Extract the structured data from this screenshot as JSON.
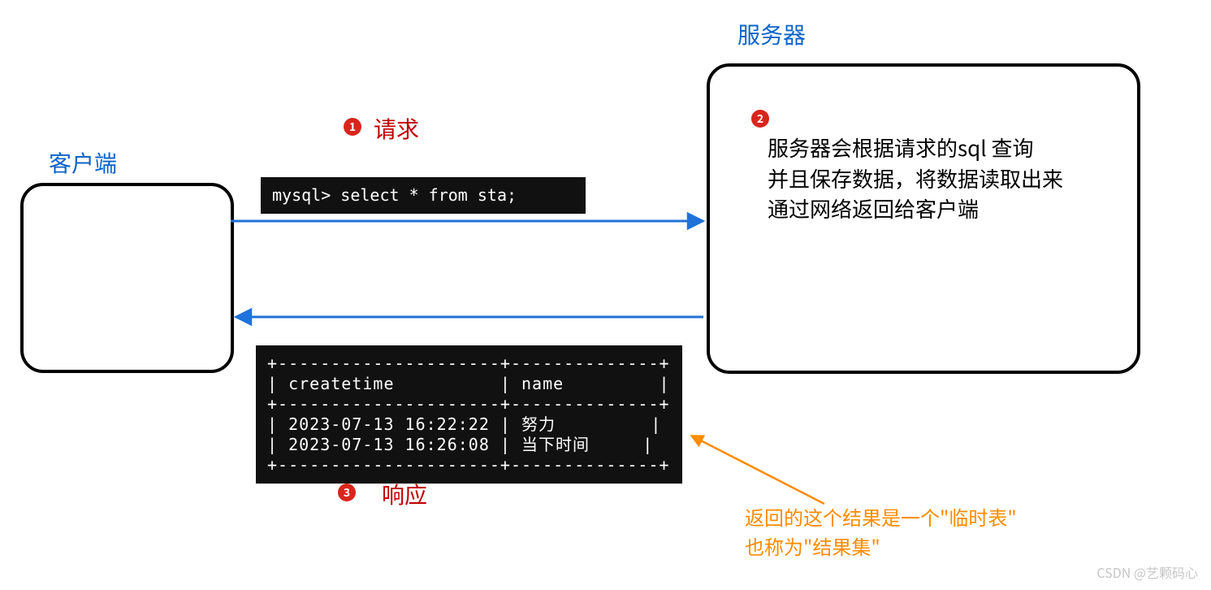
{
  "labels": {
    "client": "客户端",
    "server": "服务器",
    "request": "请求",
    "response": "响应"
  },
  "badges": {
    "b1": "1",
    "b2": "2",
    "b3": "3"
  },
  "server_text": {
    "l1": "服务器会根据请求的sql  查询",
    "l2": "并且保存数据，将数据读取出来",
    "l3": "通过网络返回给客户端"
  },
  "terminal": {
    "query": "mysql> select * from sta;",
    "result": "+---------------------+--------------+\n| createtime          | name         |\n+---------------------+--------------+\n| 2023-07-13 16:22:22 | 努力         |\n| 2023-07-13 16:26:08 | 当下时间     |\n+---------------------+--------------+"
  },
  "note": {
    "l1": "返回的这个结果是一个\"临时表\"",
    "l2": "也称为\"结果集\""
  },
  "watermark": "CSDN @艺颗码心"
}
